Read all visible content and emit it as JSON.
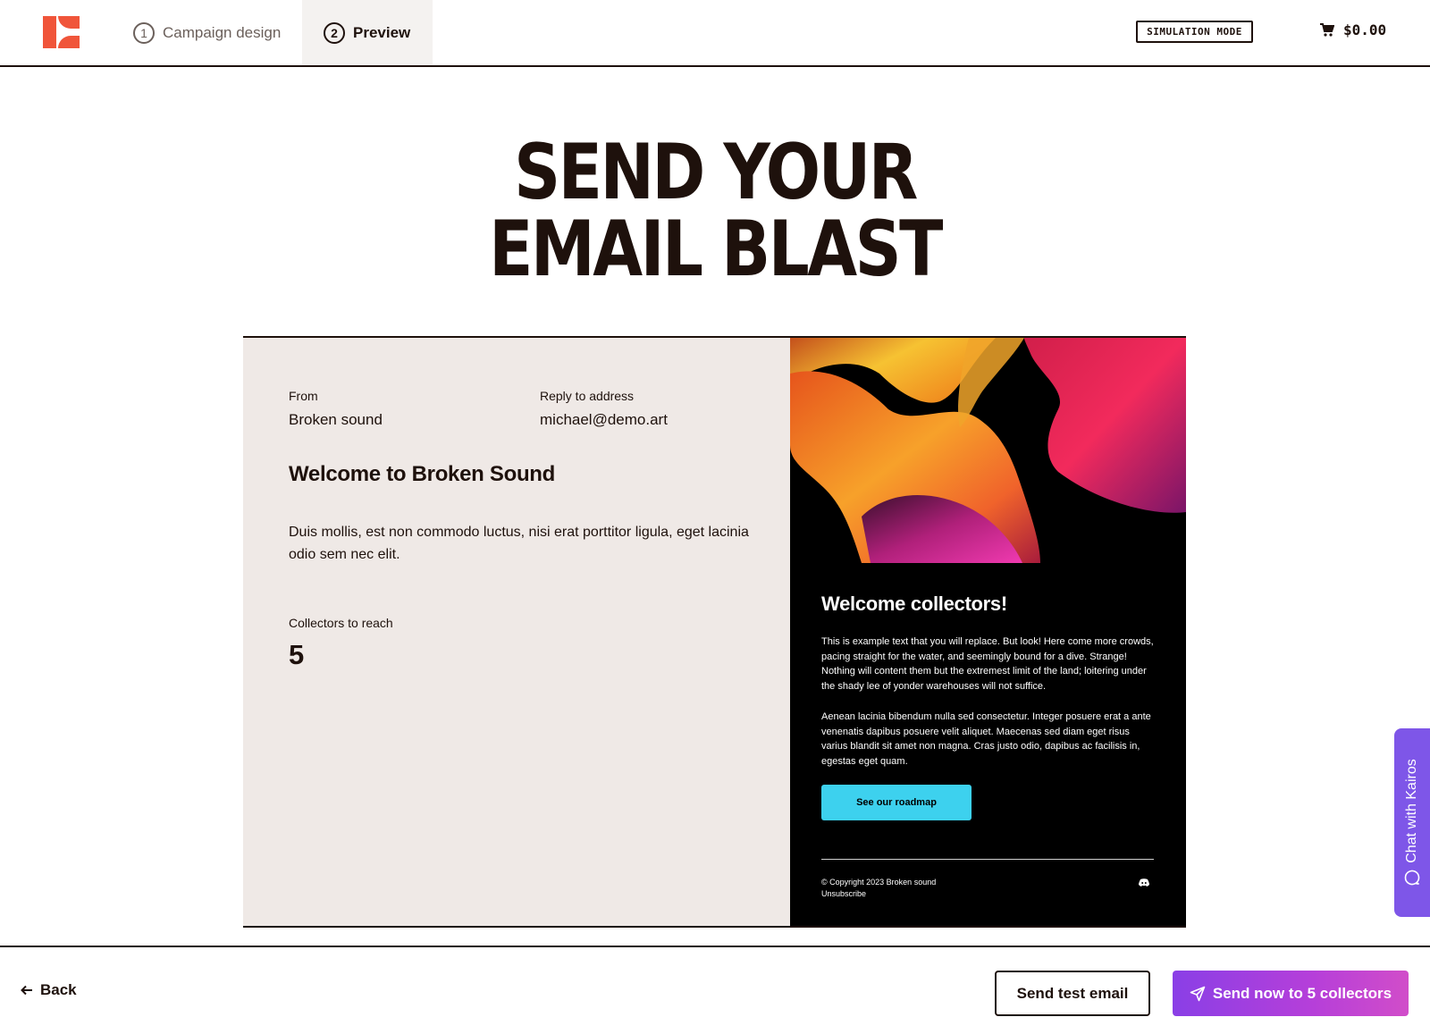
{
  "header": {
    "logo_name": "brand-logo",
    "steps": [
      {
        "number": "1",
        "label": "Campaign design"
      },
      {
        "number": "2",
        "label": "Preview"
      }
    ],
    "simulation_badge": "SIMULATION MODE",
    "cart_total": "$0.00",
    "brand_color": "#f0553a"
  },
  "page": {
    "title_line1": "SEND YOUR",
    "title_line2": "EMAIL BLAST"
  },
  "summary": {
    "from_label": "From",
    "from_value": "Broken sound",
    "reply_label": "Reply to address",
    "reply_value": "michael@demo.art",
    "subject": "Welcome to Broken Sound",
    "body": "Duis mollis, est non commodo luctus, nisi erat porttitor ligula, eget lacinia odio sem nec elit.",
    "reach_label": "Collectors to reach",
    "reach_value": "5"
  },
  "email_preview": {
    "heading": "Welcome collectors!",
    "paragraph1": "This is example text that you will replace. But look! Here come more crowds, pacing straight for the water, and seemingly bound for a dive. Strange! Nothing will content them but the extremest limit of the land; loitering under the shady lee of yonder warehouses will not suffice.",
    "paragraph2": "Aenean lacinia bibendum nulla sed consectetur. Integer posuere erat a ante venenatis dapibus posuere velit aliquet. Maecenas sed diam eget risus varius blandit sit amet non magna. Cras justo odio, dapibus ac facilisis in, egestas eget quam.",
    "button_label": "See our roadmap",
    "copyright": "© Copyright 2023 Broken sound",
    "unsubscribe": "Unsubscribe",
    "button_color": "#3dd1ee"
  },
  "chat": {
    "label": "Chat with Kairos",
    "color": "#7e56e8"
  },
  "footer": {
    "back_label": "Back",
    "test_label": "Send test email",
    "send_label": "Send now to 5 collectors"
  }
}
